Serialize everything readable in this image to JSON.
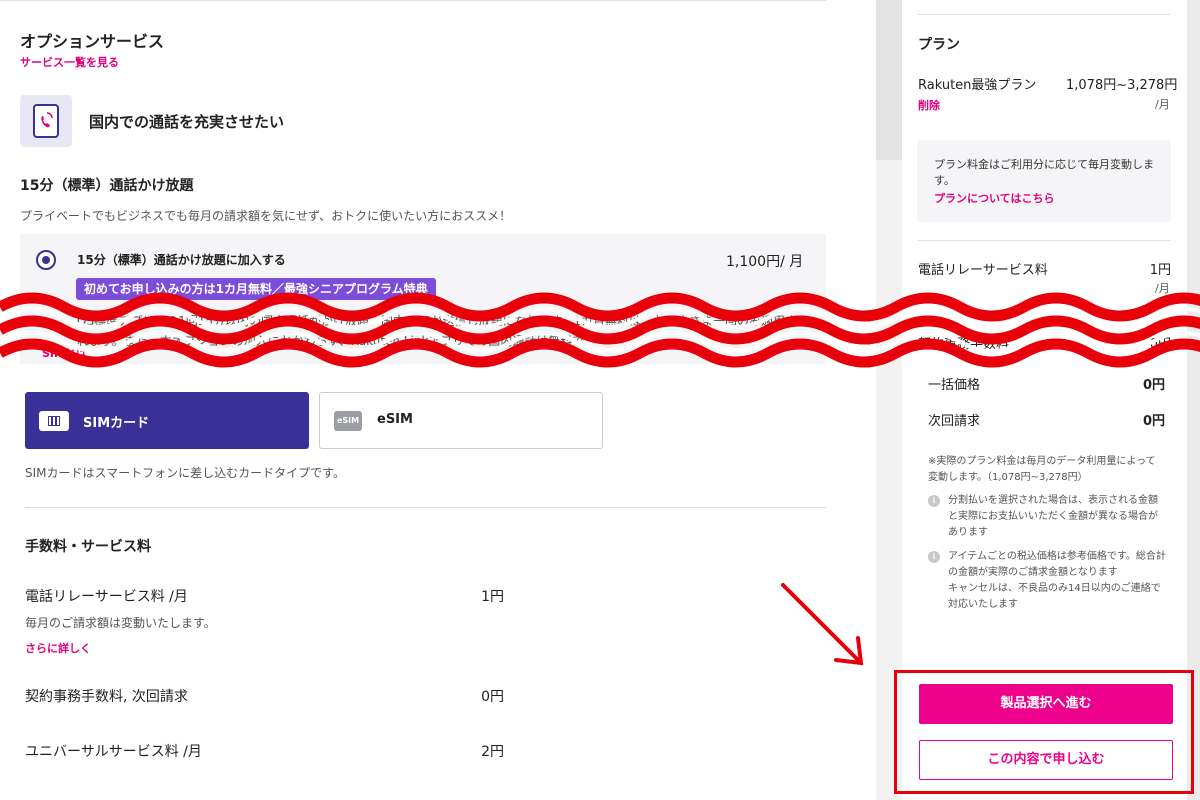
{
  "option_service": {
    "title": "オプションサービス",
    "list_link": "サービス一覧を見る",
    "category_title": "国内での通話を充実させたい",
    "plan_title": "15分（標準）通話かけ放題",
    "plan_desc": "プライベートでもビジネスでも毎月の請求額を気にせず、おトクに使いたい方におススメ！",
    "option_label": "15分（標準）通話かけ放題に加入する",
    "option_price": "1,100円/ 月",
    "promo_badge": "初めてお申し込みの方は1カ月無料／最強シニアプログラム特典",
    "option_desc": "OS標準アプリでの1回15分以内の国内通話がかけ放題、国内SMSが送信し放題になります。1カ月無料は、お一人さま一回のみ適用されます。また、本オプションの加入にかかわらず、Rakuten Linkアプリでの国内通話は無料で",
    "sim_link": "SIMとは"
  },
  "sim_type": {
    "sim_card_label": "SIMカード",
    "esim_icon_text": "eSIM",
    "esim_label": "eSIM",
    "note": "SIMカードはスマートフォンに差し込むカードタイプです。"
  },
  "fees": {
    "title": "手数料・サービス料",
    "items": [
      {
        "label": "電話リレーサービス料 /月",
        "value": "1円",
        "sub": "毎月のご請求額は変動いたします。",
        "link": "さらに詳しく"
      },
      {
        "label": "契約事務手数料, 次回請求",
        "value": "0円"
      },
      {
        "label": "ユニバーサルサービス料 /月",
        "value": "2円"
      }
    ]
  },
  "sidebar": {
    "plan_heading": "プラン",
    "plan_name": "Rakuten最強プラン",
    "plan_price": "1,078円~3,278円",
    "per_month": "/月",
    "delete_link": "削除",
    "info_text": "プラン料金はご利用分に応じて毎月変動します。",
    "info_link": "プランについてはこちら",
    "relay_label": "電話リレーサービス料",
    "relay_value": "1円",
    "relay_per": "/月",
    "contract_label": "契約事務手数料",
    "contract_value": "0円",
    "lump_label": "一括価格",
    "lump_value": "0円",
    "next_label": "次回請求",
    "next_value": "0円",
    "note": "※実際のプラン料金は毎月のデータ利用量によって変動します。（1,078円~3,278円）",
    "bullet_1": "分割払いを選択された場合は、表示される金額と実際にお支払いいただく金額が異なる場合があります",
    "bullet_2": "アイテムごとの税込価格は参考価格です。総合計の金額が実際のご請求金額となります\nキャンセルは、不良品のみ14日以内のご連絡で対応いたします",
    "primary_button": "製品選択へ進む",
    "secondary_button": "この内容で申し込む"
  },
  "colors": {
    "brand_pink": "#ec008c",
    "brand_purple": "#3b2f98",
    "promo_purple": "#7c4dd9",
    "annotation_red": "#e8000b"
  }
}
